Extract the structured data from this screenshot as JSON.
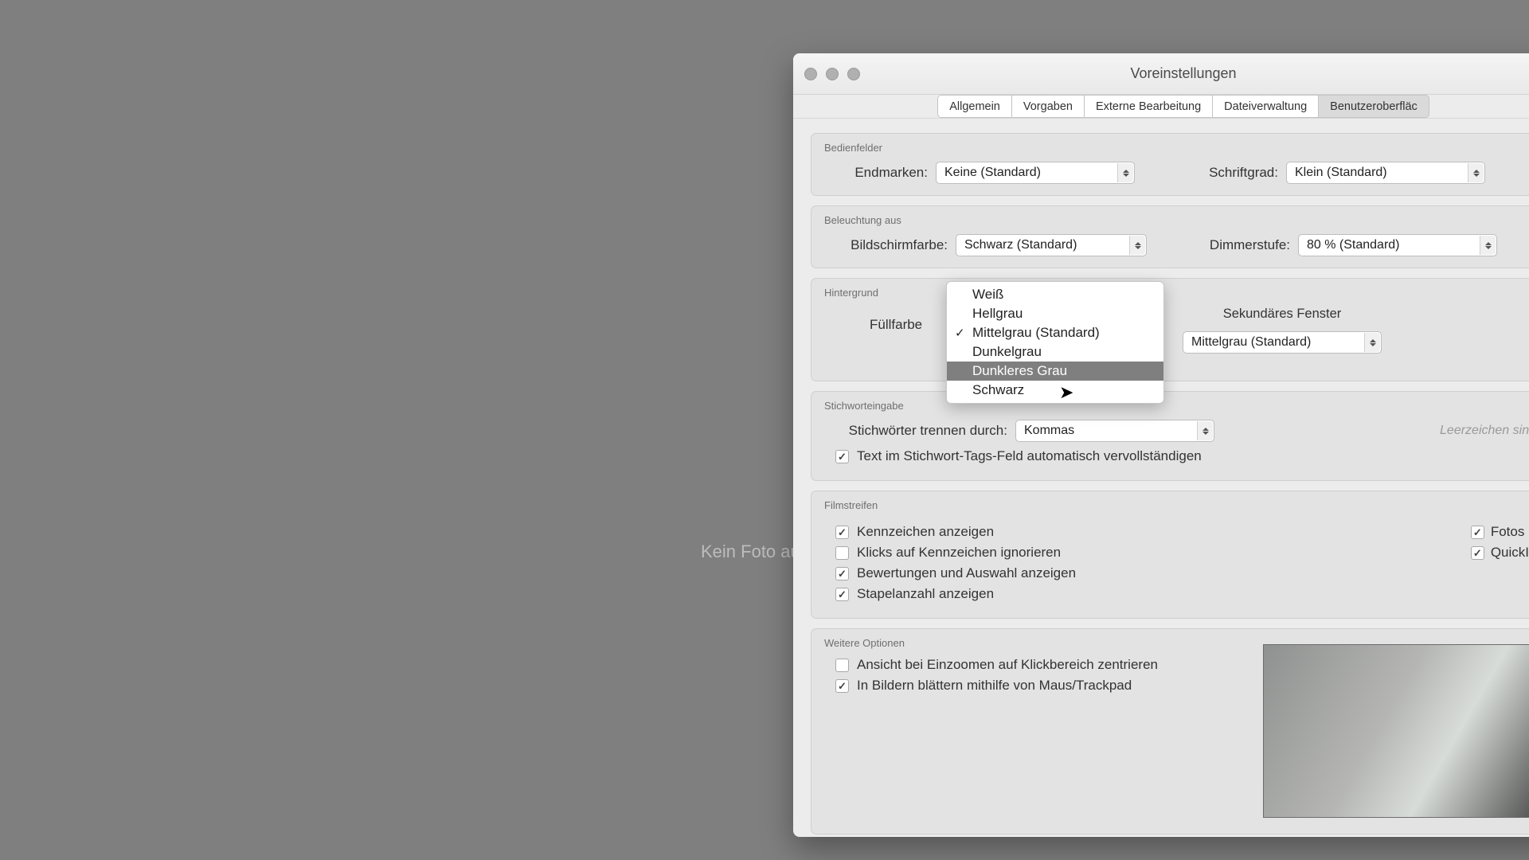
{
  "background_text": "Kein Foto au",
  "window": {
    "title": "Voreinstellungen",
    "tabs": [
      "Allgemein",
      "Vorgaben",
      "Externe Bearbeitung",
      "Dateiverwaltung",
      "Benutzeroberfläc"
    ],
    "active_tab_index": 4
  },
  "panels": {
    "bedienfelder": {
      "title": "Bedienfelder",
      "endmarken_label": "Endmarken:",
      "endmarken_value": "Keine (Standard)",
      "schriftgrad_label": "Schriftgrad:",
      "schriftgrad_value": "Klein (Standard)"
    },
    "beleuchtung": {
      "title": "Beleuchtung aus",
      "bildschirmfarbe_label": "Bildschirmfarbe:",
      "bildschirmfarbe_value": "Schwarz (Standard)",
      "dimmerstufe_label": "Dimmerstufe:",
      "dimmerstufe_value": "80 % (Standard)"
    },
    "hintergrund": {
      "title": "Hintergrund",
      "fuellfarbe_label": "Füllfarbe",
      "sekundaer_label": "Sekundäres Fenster",
      "sekundaer_value": "Mittelgrau (Standard)",
      "options": [
        "Weiß",
        "Hellgrau",
        "Mittelgrau (Standard)",
        "Dunkelgrau",
        "Dunkleres Grau",
        "Schwarz"
      ],
      "checked_index": 2,
      "highlight_index": 4
    },
    "stichworteingabe": {
      "title": "Stichworteingabe",
      "trennen_label": "Stichwörter trennen durch:",
      "trennen_value": "Kommas",
      "hint": "Leerzeichen sind i",
      "autocomplete_label": "Text im Stichwort-Tags-Feld automatisch vervollständigen",
      "autocomplete_checked": true
    },
    "filmstreifen": {
      "title": "Filmstreifen",
      "left": [
        {
          "label": "Kennzeichen anzeigen",
          "checked": true
        },
        {
          "label": "Klicks auf Kennzeichen ignorieren",
          "checked": false
        },
        {
          "label": "Bewertungen und Auswahl anzeigen",
          "checked": true
        },
        {
          "label": "Stapelanzahl anzeigen",
          "checked": true
        }
      ],
      "right": [
        {
          "label": "Fotos im",
          "checked": true
        },
        {
          "label": "QuickInf",
          "checked": true
        }
      ]
    },
    "weitere": {
      "title": "Weitere Optionen",
      "items": [
        {
          "label": "Ansicht bei Einzoomen auf Klickbereich zentrieren",
          "checked": false
        },
        {
          "label": "In Bildern blättern mithilfe von Maus/Trackpad",
          "checked": true
        }
      ]
    }
  }
}
